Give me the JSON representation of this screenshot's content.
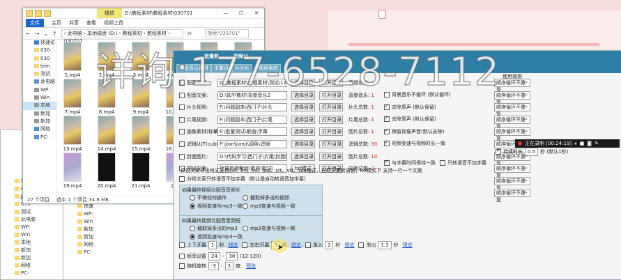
{
  "explorer": {
    "ctx_tab": "播放",
    "title": "D:\\教程素材\\教程素材\\030701",
    "ribbon": [
      "文件",
      "主页",
      "共享",
      "查看",
      "视频工具"
    ],
    "address": "› 此电脑 › 本地磁盘 (D:) › 教程素材 › 教程素材 › 030701",
    "search_placeholder": "搜索\"030701\"",
    "tree": [
      "快速访",
      "030",
      "030",
      "tem",
      "测试",
      "此电脑",
      "WP:",
      "Win",
      "本地",
      "新加",
      "新加",
      "网络",
      "PC-"
    ],
    "files": [
      "1.mp4",
      "2.mp4",
      "3.mp4",
      "4.mp4",
      "5.mp4",
      "6.mp4",
      "7.mp4",
      "8.mp4",
      "9.mp4",
      "10.mp4",
      "11.mp4",
      "12.mp4",
      "13.mp4",
      "14.mp4",
      "15.mp4",
      "16.mp4",
      "17.mp4",
      "18.mp4",
      "19.mp4",
      "20.mp4",
      "21.mp4",
      "22."
    ],
    "status": [
      "27 个项目",
      "选中 1 个项目  34.8 MB"
    ]
  },
  "mini_explorer": [
    "快速",
    "WP:",
    "Win",
    "新加",
    "新加",
    "网络",
    "PC-"
  ],
  "mini_explorer2": [
    "快速",
    "030",
    "030",
    "tem",
    "测试",
    "此电脑",
    "WP:",
    "Win",
    "本地",
    "新加",
    "新加",
    "网络",
    "PC-"
  ],
  "mini_status": "27 个项目",
  "app": {
    "tabs": [
      "批量剪",
      "视频分"
    ],
    "toolbar": [
      "导出音乐素材",
      "主要设置",
      "片头片",
      "视频素材"
    ],
    "rows": [
      {
        "label": "配置音频:",
        "value": "D:\\教程素材\\教程素材\\测试\\123\\无声",
        "btn1": "选择目录",
        "btn2": "打开目录",
        "count_label": "音频总数:",
        "count": "1"
      },
      {
        "label": "配音文案:",
        "value": "D:\\知乎教材\\背景音乐2",
        "btn1": "选择目录",
        "btn2": "打开目录",
        "count_label": "背景音乐:",
        "count": "1"
      },
      {
        "label": "片头视频:",
        "value": "F:\\问题副本\\西门子\\片头",
        "btn1": "选择目录",
        "btn2": "打开目录",
        "count_label": "片头总数:",
        "count": "1"
      },
      {
        "label": "片尾视频:",
        "value": "F:\\问题副本\\西门子\\片尾",
        "btn1": "选择目录",
        "btn2": "打开目录",
        "count_label": "片尾总数:",
        "count": "1"
      },
      {
        "label": "画像素材(标摹版):",
        "value": "F:\\批量测试\\歌曲\\字幕",
        "btn1": "选择目录",
        "btn2": "打开目录",
        "count_label": "图片总数:",
        "count": "1"
      },
      {
        "label": "滤镜LUT(cube):",
        "value": "F:\\jian\\jianji\\调色\\滤镜",
        "btn1": "选择目录",
        "btn2": "打开目录",
        "count_label": "滤镜总数:",
        "count": "30"
      },
      {
        "label": "封面图片:",
        "value": "D:\\代码学习\\西门子\\片尾\\封面图",
        "btn1": "选择目录",
        "btn2": "打开目录",
        "count_label": "图片总数:",
        "count": "10"
      },
      {
        "label": "预设文案:",
        "value": "批量剪辑教程\\歌曲\\歌词\\",
        "btn1": "txt模式",
        "btn2": "打开目录",
        "count_label": "文案总数:",
        "count": "2"
      }
    ],
    "use_rule_title": "使用规则",
    "right_opts": [
      {
        "label": "背景音乐不循环 (默认循环)",
        "on": false
      },
      {
        "label": "去除原声 (默认保留)",
        "on": true
      },
      {
        "label": "去除原声 (默认保留)",
        "on": true
      },
      {
        "label": "保留视像声音(默认去除)",
        "on": true
      },
      {
        "label": "视频变速与视频时长一致",
        "on": true
      }
    ],
    "selects": [
      "顺序循环不重复",
      "顺序循环不重复",
      "顺序循环不重复",
      "顺序循环不重复",
      "顺序循环不重复",
      "顺序循环不重复",
      "顺序循环不重复",
      "顺序循环不重复",
      "顺序循环不重复",
      "顺序循环不重复"
    ],
    "duration_label": "持续时长",
    "duration_value": "0.5",
    "duration_unit": "秒 (默认1秒)",
    "sync_label": "与字幕时间保持一致",
    "only_voice_label": "只转语音不加字幕",
    "format_note": "预设文案导出格式支持txt、lrc、lrc、ass、srt、vtt、ssa格式，自动文案转语音，txt模式下 支持一行一个文案",
    "split_note": "分段文案只转语音不加字幕（默认是自动转语音加字幕）",
    "group1": {
      "title": "如果最终视频比配音音频长",
      "opts": [
        "不做任何操作",
        "截取掉多出的视频",
        "视频变速与mp3一致",
        "mp3变速与视频一致"
      ],
      "on": 2
    },
    "group2": {
      "title": "如果最终视频比配音音频短",
      "opts": [
        "截取掉多出的mp3",
        "mp3变速与视频一致",
        "视频变速与mp3一致"
      ],
      "on": 2
    },
    "bottom": {
      "flip_ud": "上下开幕",
      "flip_ud_v": "1",
      "flip_lr": "左右开幕",
      "flip_lr_v": "3",
      "fade_in": "渐入",
      "fade_in_v": "2",
      "fade_out": "渐出",
      "fade_out_v": "1.3",
      "unit": "秒",
      "preview": "预览",
      "fps": "帧率设置",
      "fps_a": "24",
      "fps_b": "30",
      "fps_range": "(12-120)",
      "rotate": "随机旋转",
      "rot_a": "-3",
      "rot_b": "3",
      "rot_unit": "度"
    }
  },
  "recorder": {
    "label": "正在录制 [00:24:19]"
  },
  "watermark": "详询:177-6528-7112"
}
